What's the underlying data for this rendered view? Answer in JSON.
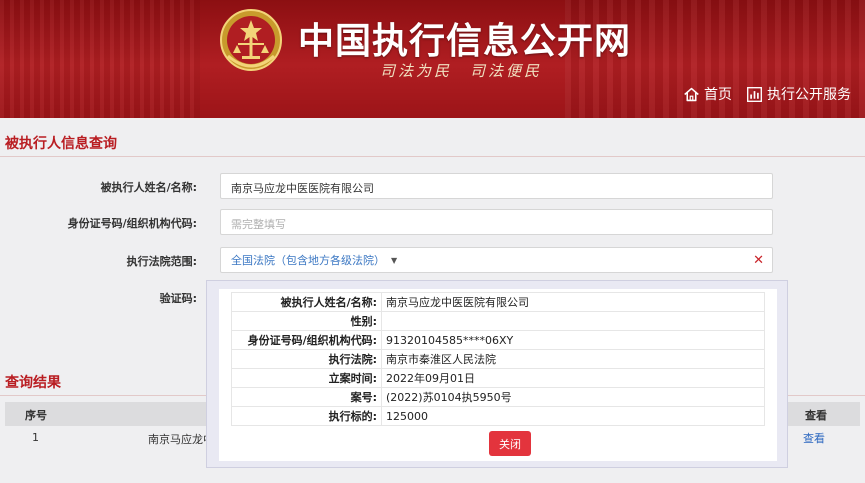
{
  "header": {
    "site_title": "中国执行信息公开网",
    "slogan": "司法为民　司法便民",
    "nav": [
      {
        "label": "首页",
        "icon": "home-icon"
      },
      {
        "label": "执行公开服务",
        "icon": "chart-icon"
      }
    ]
  },
  "query": {
    "section_title": "被执行人信息查询",
    "name_label": "被执行人姓名/名称:",
    "name_value": "南京马应龙中医医院有限公司",
    "id_label": "身份证号码/组织机构代码:",
    "id_placeholder": "需完整填写",
    "court_label": "执行法院范围:",
    "court_value": "全国法院（包含地方各级法院）",
    "captcha_label": "验证码:"
  },
  "results": {
    "section_title": "查询结果",
    "headers": {
      "index": "序号",
      "view": "查看"
    },
    "rows": [
      {
        "index": "1",
        "name": "南京马应龙中",
        "view": "查看"
      }
    ]
  },
  "detail": {
    "fields": [
      {
        "key": "被执行人姓名/名称:",
        "value": "南京马应龙中医医院有限公司"
      },
      {
        "key": "性别:",
        "value": ""
      },
      {
        "key": "身份证号码/组织机构代码:",
        "value": "91320104585****06XY"
      },
      {
        "key": "执行法院:",
        "value": "南京市秦淮区人民法院"
      },
      {
        "key": "立案时间:",
        "value": "2022年09月01日"
      },
      {
        "key": "案号:",
        "value": "(2022)苏0104执5950号"
      },
      {
        "key": "执行标的:",
        "value": "125000"
      }
    ],
    "close_label": "关闭"
  },
  "colors": {
    "brand_red": "#b01e22",
    "accent_blue": "#2b67c0",
    "close_button": "#e3343d"
  }
}
